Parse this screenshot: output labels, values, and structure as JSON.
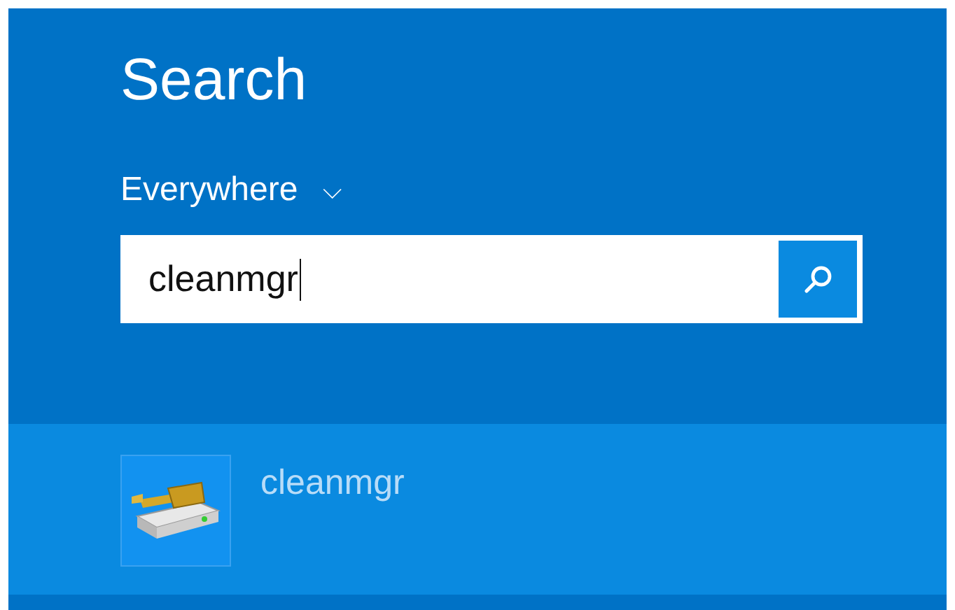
{
  "title": "Search",
  "scope": {
    "label": "Everywhere",
    "symbol": "⌵"
  },
  "search": {
    "value": "cleanmgr"
  },
  "results": [
    {
      "label": "cleanmgr",
      "selected": true
    }
  ]
}
